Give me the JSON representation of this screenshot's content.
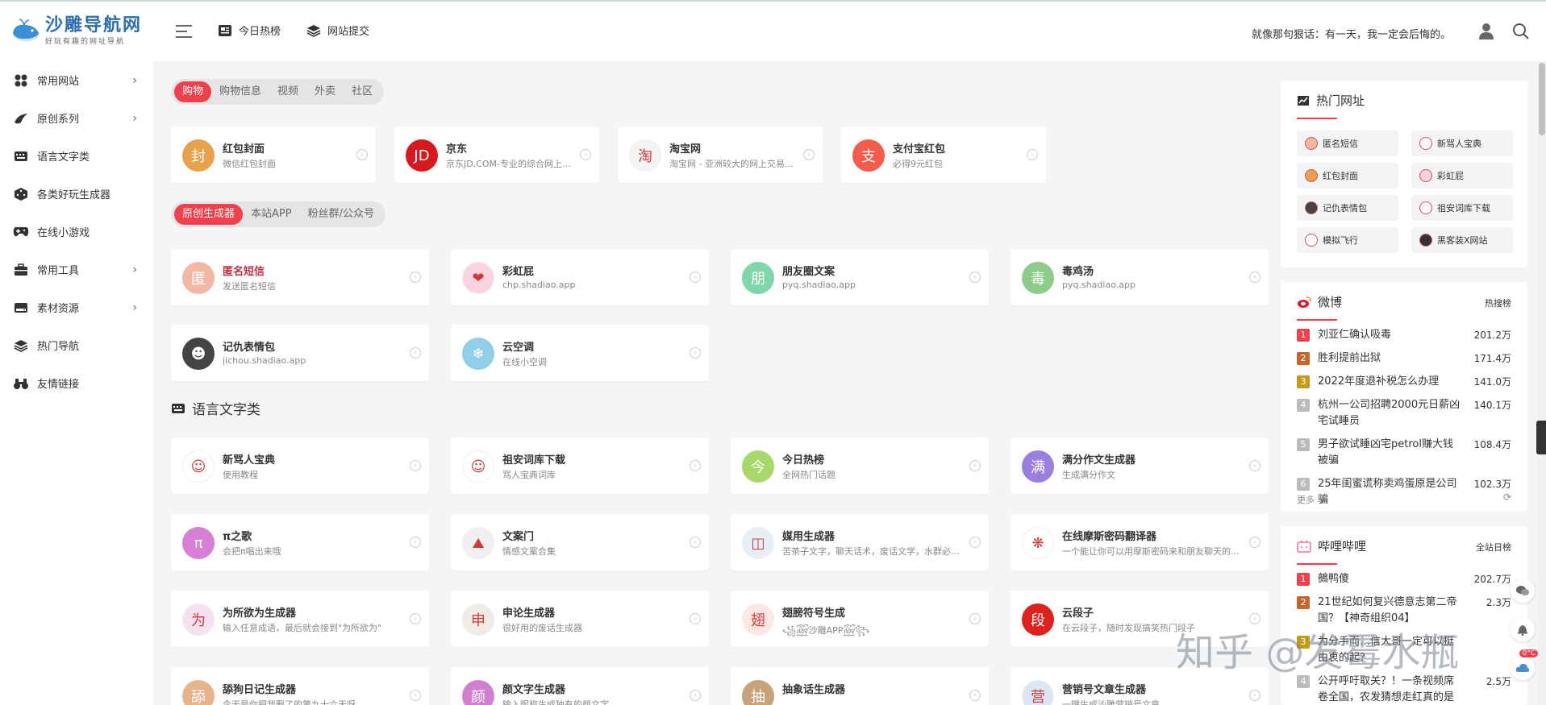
{
  "header": {
    "logo_title": "沙雕导航网",
    "logo_sub": "好玩有趣的网址导航",
    "nav": [
      {
        "label": "今日热榜",
        "icon": "newspaper-icon"
      },
      {
        "label": "网站提交",
        "icon": "layers-icon"
      }
    ],
    "motto": "就像那句狠话：有一天，我一定会后悔的。"
  },
  "sidebar": {
    "items": [
      {
        "label": "常用网站",
        "icon": "grid-icon",
        "chevron": true
      },
      {
        "label": "原创系列",
        "icon": "pen-icon",
        "chevron": true
      },
      {
        "label": "语言文字类",
        "icon": "keyboard-icon",
        "chevron": false
      },
      {
        "label": "各类好玩生成器",
        "icon": "dice-icon",
        "chevron": false
      },
      {
        "label": "在线小游戏",
        "icon": "gamepad-icon",
        "chevron": false
      },
      {
        "label": "常用工具",
        "icon": "toolbox-icon",
        "chevron": true
      },
      {
        "label": "素材资源",
        "icon": "drive-icon",
        "chevron": true
      },
      {
        "label": "热门导航",
        "icon": "layers-icon",
        "chevron": false
      },
      {
        "label": "友情链接",
        "icon": "binoculars-icon",
        "chevron": false
      }
    ]
  },
  "tabs1": [
    "购物",
    "购物信息",
    "视频",
    "外卖",
    "社区"
  ],
  "tabs2": [
    "原创生成器",
    "本站APP",
    "粉丝群/公众号"
  ],
  "shop_cards": [
    {
      "title": "红包封面",
      "desc": "微信红包封面",
      "color": "#e8a04c",
      "glyph": "封"
    },
    {
      "title": "京东",
      "desc": "京东JD.COM-专业的综合网上...",
      "color": "#d8181c",
      "glyph": "JD"
    },
    {
      "title": "淘宝网",
      "desc": "淘宝网 - 亚洲较大的网上交易...",
      "color": "#f4f4f4",
      "glyph": "淘"
    },
    {
      "title": "支付宝红包",
      "desc": "必得9元红包",
      "color": "#f35b4b",
      "glyph": "支"
    }
  ],
  "orig_cards": [
    {
      "title": "匿名短信",
      "desc": "发送匿名短信",
      "color": "#f2b8a4",
      "glyph": "匿",
      "red": true
    },
    {
      "title": "彩虹屁",
      "desc": "chp.shadiao.app",
      "color": "#fbd3de",
      "glyph": "❤",
      "red": false
    },
    {
      "title": "朋友圈文案",
      "desc": "pyq.shadiao.app",
      "color": "#7fd6a8",
      "glyph": "朋",
      "red": false
    },
    {
      "title": "毒鸡汤",
      "desc": "pyq.shadiao.app",
      "color": "#8ccb8a",
      "glyph": "毒",
      "red": false
    },
    {
      "title": "记仇表情包",
      "desc": "jichou.shadiao.app",
      "color": "#444444",
      "glyph": "☻",
      "red": false
    },
    {
      "title": "云空调",
      "desc": "在线小空调",
      "color": "#8fd0e8",
      "glyph": "❄",
      "red": false
    }
  ],
  "section_lang": {
    "title": "语言文字类"
  },
  "lang_cards": [
    {
      "title": "新骂人宝典",
      "desc": "使用教程",
      "color": "#ffffff",
      "glyph": "☺"
    },
    {
      "title": "祖安词库下载",
      "desc": "骂人宝典词库",
      "color": "#ffffff",
      "glyph": "☺"
    },
    {
      "title": "今日热榜",
      "desc": "全网热门话题",
      "color": "#a6d96a",
      "glyph": "今"
    },
    {
      "title": "满分作文生成器",
      "desc": "生成满分作文",
      "color": "#9b7fe0",
      "glyph": "满"
    },
    {
      "title": "π之歌",
      "desc": "会把π唱出来哦",
      "color": "#d77fd6",
      "glyph": "π"
    },
    {
      "title": "文案门",
      "desc": "情感文案合集",
      "color": "#f0f0f0",
      "glyph": "⛰"
    },
    {
      "title": "媒用生成器",
      "desc": "苦茶子文字，聊天话术，废话文学，水群必...",
      "color": "#e6eef6",
      "glyph": "◫"
    },
    {
      "title": "在线摩斯密码翻译器",
      "desc": "一个能让你可以用摩斯密码来和朋友聊天的...",
      "color": "#ffffff",
      "glyph": "❋"
    },
    {
      "title": "为所欲为生成器",
      "desc": "输入任意成语，最后就会接到\"为所欲为\"",
      "color": "#f5e1f0",
      "glyph": "为"
    },
    {
      "title": "申论生成器",
      "desc": "很好用的废话生成器",
      "color": "#f0ece4",
      "glyph": "申"
    },
    {
      "title": "翅膀符号生成",
      "desc": "꧁꫞沙雕APP꫞꧂",
      "color": "#fde8e4",
      "glyph": "翅"
    },
    {
      "title": "云段子",
      "desc": "在云段子，随时发现搞笑热门段子",
      "color": "#e0201d",
      "glyph": "段"
    },
    {
      "title": "舔狗日记生成器",
      "desc": "今天是你把我删了的第九十六天呀",
      "color": "#e5b48a",
      "glyph": "舔"
    },
    {
      "title": "颜文字生成器",
      "desc": "输入昵称生成独有的颜文字",
      "color": "#d07fd0",
      "glyph": "颜"
    },
    {
      "title": "抽象话生成器",
      "desc": "",
      "color": "#c8a27a",
      "glyph": "抽"
    },
    {
      "title": "营销号文章生成器",
      "desc": "一键生成沙雕营销号文章",
      "color": "#dbe6f5",
      "glyph": "营"
    }
  ],
  "hot_sites": {
    "title": "热门网址",
    "items": [
      {
        "label": "匿名短信",
        "color": "#f2b8a4"
      },
      {
        "label": "新骂人宝典",
        "color": "#ffffff"
      },
      {
        "label": "红包封面",
        "color": "#e8a04c"
      },
      {
        "label": "彩虹屁",
        "color": "#fbd3de"
      },
      {
        "label": "记仇表情包",
        "color": "#444444"
      },
      {
        "label": "祖安词库下载",
        "color": "#ffffff"
      },
      {
        "label": "模拟飞行",
        "color": "#ffffff"
      },
      {
        "label": "黑客装X网站",
        "color": "#333333"
      }
    ]
  },
  "weibo": {
    "title": "微博",
    "right": "热搜榜",
    "items": [
      {
        "rank": "1",
        "text": "刘亚仁确认吸毒",
        "value": "201.2万",
        "color": "#f1404b"
      },
      {
        "rank": "2",
        "text": "胜利提前出狱",
        "value": "171.4万",
        "color": "#c6662a"
      },
      {
        "rank": "3",
        "text": "2022年度退补税怎么办理",
        "value": "141.0万",
        "color": "#c49a16"
      },
      {
        "rank": "4",
        "text": "杭州一公司招聘2000元日薪凶宅试睡员",
        "value": "140.1万",
        "color": "#bbbbbb"
      },
      {
        "rank": "5",
        "text": "男子欲试睡凶宅petrol赚大钱被骗",
        "value": "108.4万",
        "color": "#bbbbbb"
      },
      {
        "rank": "6",
        "text": "25年闺蜜谎称卖鸡蛋原是公司骗",
        "value": "102.3万",
        "color": "#bbbbbb"
      }
    ],
    "more": "更多"
  },
  "bilibili": {
    "title": "哔哩哔哩",
    "right": "全站日榜",
    "items": [
      {
        "rank": "1",
        "text": "鵺鸭傻",
        "value": "202.7万",
        "color": "#f1404b"
      },
      {
        "rank": "2",
        "text": "21世纪如何复兴德意志第二帝国？【神奇组织04】",
        "value": "2.3万",
        "color": "#c6662a"
      },
      {
        "rank": "3",
        "text": "为分手而…信大哥一定可以挺由衷的起？",
        "value": "",
        "color": "#c49a16"
      },
      {
        "rank": "4",
        "text": "公开呼吁取关？！一条视频席卷全国，农发猜想走红真的是偶然吗？",
        "value": "2.5万",
        "color": "#bbbbbb"
      }
    ]
  },
  "watermark": "知乎 @发霉水瓶",
  "weather_badge": "0°C"
}
